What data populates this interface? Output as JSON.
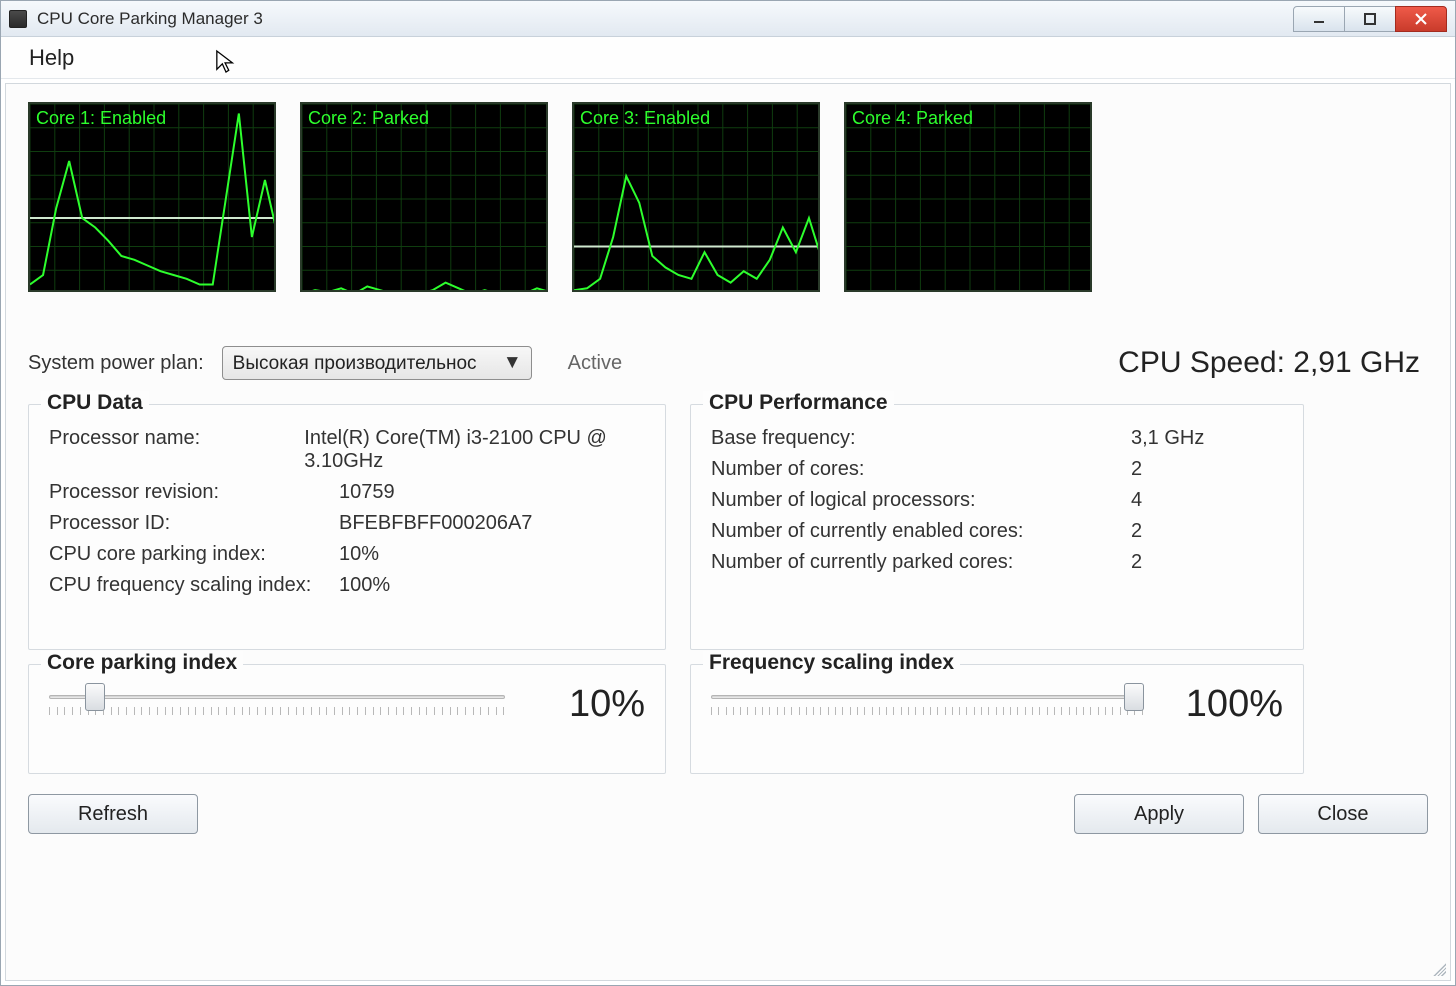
{
  "window": {
    "title": "CPU Core Parking Manager 3"
  },
  "menu": {
    "help": "Help"
  },
  "cores": [
    {
      "label": "Core 1: Enabled"
    },
    {
      "label": "Core 2: Parked"
    },
    {
      "label": "Core 3: Enabled"
    },
    {
      "label": "Core 4: Parked"
    }
  ],
  "power_plan": {
    "label": "System power plan:",
    "selected": "Высокая производительнос",
    "status": "Active"
  },
  "cpu_speed": {
    "label": "CPU Speed: 2,91 GHz"
  },
  "cpu_data": {
    "legend": "CPU Data",
    "processor_name_label": "Processor name:",
    "processor_name_value": "Intel(R) Core(TM) i3-2100 CPU @ 3.10GHz",
    "processor_revision_label": "Processor revision:",
    "processor_revision_value": "10759",
    "processor_id_label": "Processor ID:",
    "processor_id_value": "BFEBFBFF000206A7",
    "parking_index_label": "CPU core parking index:",
    "parking_index_value": "10%",
    "freq_scaling_label": "CPU frequency scaling index:",
    "freq_scaling_value": "100%"
  },
  "cpu_perf": {
    "legend": "CPU Performance",
    "base_freq_label": "Base frequency:",
    "base_freq_value": "3,1 GHz",
    "num_cores_label": "Number of cores:",
    "num_cores_value": "2",
    "num_logical_label": "Number of logical processors:",
    "num_logical_value": "4",
    "num_enabled_label": "Number of currently enabled cores:",
    "num_enabled_value": "2",
    "num_parked_label": "Number of currently parked cores:",
    "num_parked_value": "2"
  },
  "sliders": {
    "parking": {
      "legend": "Core parking index",
      "value_text": "10%",
      "percent": 10
    },
    "frequency": {
      "legend": "Frequency scaling index",
      "value_text": "100%",
      "percent": 100
    }
  },
  "buttons": {
    "refresh": "Refresh",
    "apply": "Apply",
    "close": "Close"
  },
  "chart_data": [
    {
      "type": "line",
      "title": "Core 1: Enabled",
      "xlabel": "",
      "ylabel": "",
      "ylim": [
        0,
        100
      ],
      "x": [
        0,
        1,
        2,
        3,
        4,
        5,
        6,
        7,
        8,
        9,
        10,
        11,
        12,
        13,
        14,
        15,
        16,
        17,
        18,
        19
      ],
      "values": [
        5,
        10,
        45,
        70,
        40,
        35,
        28,
        20,
        18,
        15,
        12,
        10,
        8,
        5,
        5,
        50,
        95,
        30,
        60,
        30
      ],
      "baseline": 40
    },
    {
      "type": "line",
      "title": "Core 2: Parked",
      "xlabel": "",
      "ylabel": "",
      "ylim": [
        0,
        100
      ],
      "x": [
        0,
        1,
        2,
        3,
        4,
        5,
        6,
        7,
        8,
        9,
        10,
        11,
        12,
        13,
        14,
        15,
        16,
        17,
        18,
        19
      ],
      "values": [
        0,
        2,
        1,
        3,
        0,
        4,
        2,
        0,
        1,
        0,
        2,
        6,
        3,
        0,
        2,
        0,
        1,
        0,
        3,
        1
      ]
    },
    {
      "type": "line",
      "title": "Core 3: Enabled",
      "xlabel": "",
      "ylabel": "",
      "ylim": [
        0,
        100
      ],
      "x": [
        0,
        1,
        2,
        3,
        4,
        5,
        6,
        7,
        8,
        9,
        10,
        11,
        12,
        13,
        14,
        15,
        16,
        17,
        18,
        19
      ],
      "values": [
        2,
        3,
        8,
        30,
        62,
        48,
        20,
        14,
        10,
        8,
        22,
        10,
        6,
        12,
        8,
        18,
        35,
        22,
        40,
        18
      ],
      "baseline": 25
    },
    {
      "type": "line",
      "title": "Core 4: Parked",
      "xlabel": "",
      "ylabel": "",
      "ylim": [
        0,
        100
      ],
      "x": [
        0,
        1,
        2,
        3,
        4,
        5,
        6,
        7,
        8,
        9,
        10,
        11,
        12,
        13,
        14,
        15,
        16,
        17,
        18,
        19
      ],
      "values": [
        0,
        0,
        0,
        0,
        0,
        0,
        0,
        0,
        0,
        0,
        0,
        0,
        0,
        0,
        0,
        0,
        0,
        0,
        0,
        0
      ]
    }
  ]
}
